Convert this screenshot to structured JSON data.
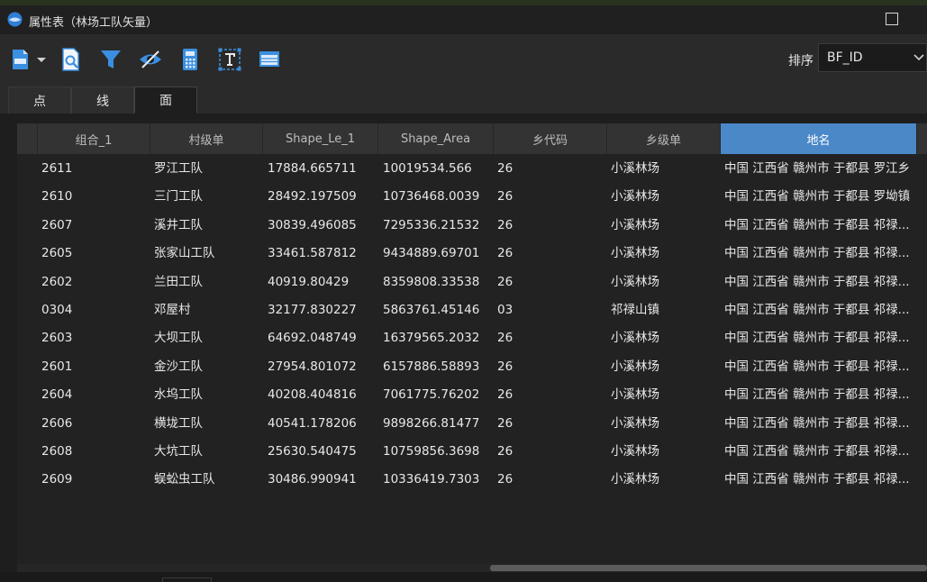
{
  "window": {
    "title": "属性表（林场工队矢量）"
  },
  "toolbar": {
    "buttons": [
      {
        "icon": "export-csv-icon"
      },
      {
        "icon": "inspect-icon"
      },
      {
        "icon": "filter-icon"
      },
      {
        "icon": "hide-icon"
      },
      {
        "icon": "calculator-icon"
      },
      {
        "icon": "text-field-icon"
      },
      {
        "icon": "table-window-icon"
      }
    ],
    "sort_label": "排序",
    "sort_value": "BF_ID"
  },
  "tabs": [
    {
      "label": "点",
      "active": false
    },
    {
      "label": "线",
      "active": false
    },
    {
      "label": "面",
      "active": true
    }
  ],
  "table": {
    "columns": [
      "组合_1",
      "村级单",
      "Shape_Le_1",
      "Shape_Area",
      "乡代码",
      "乡级单",
      "地名"
    ],
    "selected_column": "地名",
    "rows": [
      [
        "2611",
        "罗江工队",
        "17884.665711",
        "10019534.566",
        "26",
        "小溪林场",
        "中国 江西省 赣州市 于都县 罗江乡"
      ],
      [
        "2610",
        "三门工队",
        "28492.197509",
        "10736468.0039",
        "26",
        "小溪林场",
        "中国 江西省 赣州市 于都县 罗坳镇"
      ],
      [
        "2607",
        "溪井工队",
        "30839.496085",
        "7295336.21532",
        "26",
        "小溪林场",
        "中国 江西省 赣州市 于都县 祁禄..."
      ],
      [
        "2605",
        "张家山工队",
        "33461.587812",
        "9434889.69701",
        "26",
        "小溪林场",
        "中国 江西省 赣州市 于都县 祁禄..."
      ],
      [
        "2602",
        "兰田工队",
        "40919.80429",
        "8359808.33538",
        "26",
        "小溪林场",
        "中国 江西省 赣州市 于都县 祁禄..."
      ],
      [
        "0304",
        "邓屋村",
        "32177.830227",
        "5863761.45146",
        "03",
        "祁禄山镇",
        "中国 江西省 赣州市 于都县 祁禄..."
      ],
      [
        "2603",
        "大坝工队",
        "64692.048749",
        "16379565.2032",
        "26",
        "小溪林场",
        "中国 江西省 赣州市 于都县 祁禄..."
      ],
      [
        "2601",
        "金沙工队",
        "27954.801072",
        "6157886.58893",
        "26",
        "小溪林场",
        "中国 江西省 赣州市 于都县 祁禄..."
      ],
      [
        "2604",
        "水坞工队",
        "40208.404816",
        "7061775.76202",
        "26",
        "小溪林场",
        "中国 江西省 赣州市 于都县 祁禄..."
      ],
      [
        "2606",
        "横垅工队",
        "40541.178206",
        "9898266.81477",
        "26",
        "小溪林场",
        "中国 江西省 赣州市 于都县 祁禄..."
      ],
      [
        "2608",
        "大坑工队",
        "25630.540475",
        "10759856.3698",
        "26",
        "小溪林场",
        "中国 江西省 赣州市 于都县 祁禄..."
      ],
      [
        "2609",
        "蜈蚣虫工队",
        "30486.990941",
        "10336419.7303",
        "26",
        "小溪林场",
        "中国 江西省 赣州市 于都县 祁禄..."
      ]
    ]
  },
  "colors": {
    "background": "#1e1e1e",
    "header_bg": "#333333",
    "selected_header": "#4a88c8",
    "icon_blue": "#3b8fe0"
  }
}
